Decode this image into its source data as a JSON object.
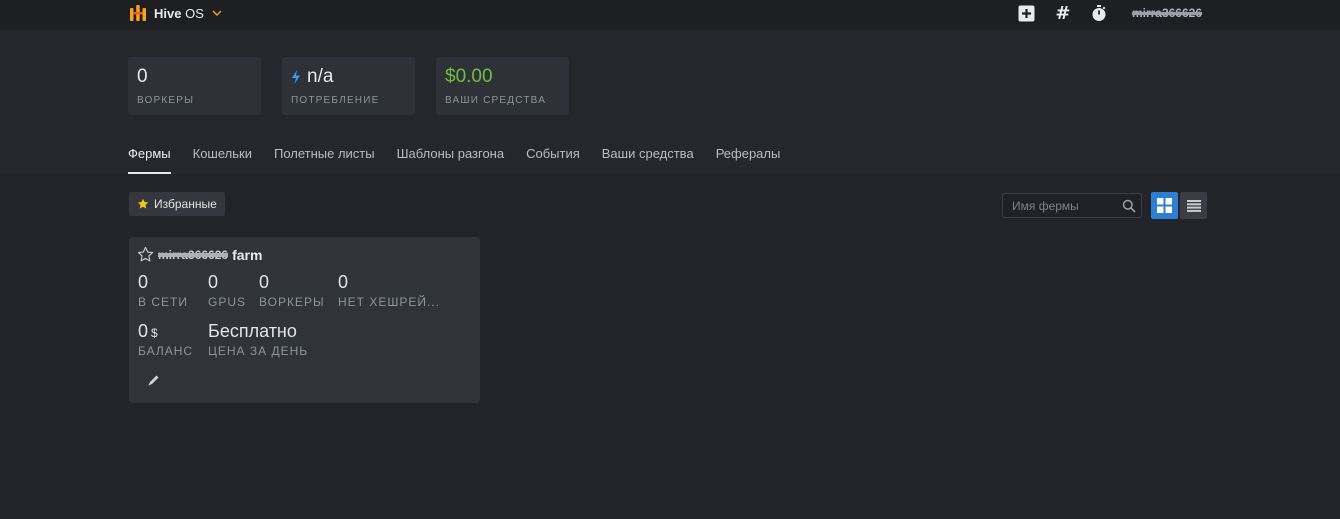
{
  "app": {
    "brand": "Hive",
    "brand_suffix": "OS",
    "username": "mirra366626"
  },
  "top_actions": {
    "add_icon": "plus-square-icon",
    "hash_label": "#",
    "timer_icon": "stopwatch-icon"
  },
  "stats": [
    {
      "value": "0",
      "label": "Воркеры"
    },
    {
      "value": "n/a",
      "label": "Потребление"
    },
    {
      "value": "$0.00",
      "label": "Ваши средства"
    }
  ],
  "colors": {
    "accent_blue": "#2f7fd1",
    "money_green": "#6fbf3f",
    "star_yellow": "#f5c518",
    "logo_orange": "#f7a21b"
  },
  "tabs": [
    {
      "label": "Фермы",
      "active": true
    },
    {
      "label": "Кошельки"
    },
    {
      "label": "Полетные листы"
    },
    {
      "label": "Шаблоны разгона"
    },
    {
      "label": "События"
    },
    {
      "label": "Ваши средства"
    },
    {
      "label": "Рефералы"
    }
  ],
  "toolbar": {
    "favorites_label": "Избранные",
    "search_placeholder": "Имя фермы"
  },
  "farm": {
    "owner": "mirra366626",
    "name": "farm",
    "stats": [
      {
        "value": "0",
        "label": "В сети"
      },
      {
        "value": "0",
        "label": "GPUs"
      },
      {
        "value": "0",
        "label": "Воркеры"
      },
      {
        "value": "0",
        "label": "Нет хешрей..."
      }
    ],
    "balance": {
      "value": "0",
      "currency": "$",
      "label": "Баланс"
    },
    "price": {
      "value": "Бесплатно",
      "label": "Цена за день"
    }
  }
}
